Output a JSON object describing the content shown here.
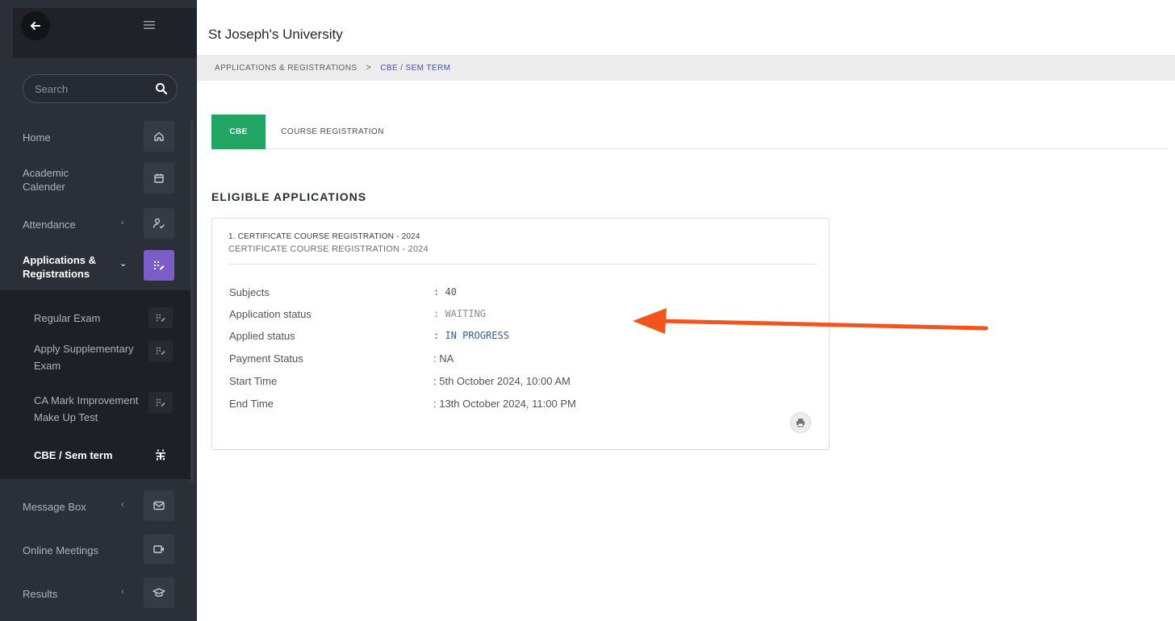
{
  "sidebar": {
    "search_placeholder": "Search",
    "items": [
      {
        "label": "Home"
      },
      {
        "label": "Academic\nCalender"
      },
      {
        "label": "Attendance"
      },
      {
        "label": "Applications &\nRegistrations"
      },
      {
        "label": "Message Box"
      },
      {
        "label": "Online Meetings"
      },
      {
        "label": "Results"
      }
    ],
    "submenu": [
      {
        "label": "Regular Exam"
      },
      {
        "label": "Apply Supplementary\nExam"
      },
      {
        "label": "CA Mark Improvement\nMake Up Test"
      },
      {
        "label": "CBE / Sem term"
      }
    ]
  },
  "header": {
    "title": "St Joseph's University"
  },
  "breadcrumb": {
    "root": "APPLICATIONS & REGISTRATIONS",
    "separator": ">",
    "current": "CBE / SEM TERM"
  },
  "tabs": [
    {
      "label": "CBE"
    },
    {
      "label": "COURSE REGISTRATION"
    }
  ],
  "section": {
    "title": "ELIGIBLE APPLICATIONS"
  },
  "card": {
    "heading": "1. CERTIFICATE COURSE REGISTRATION - 2024",
    "subheading": "CERTIFICATE COURSE REGISTRATION - 2024",
    "rows": [
      {
        "label": "Subjects",
        "value": ": 40"
      },
      {
        "label": "Application status",
        "value": ": WAITING"
      },
      {
        "label": "Applied status",
        "value": ": IN PROGRESS"
      },
      {
        "label": "Payment Status",
        "value": ": NA"
      },
      {
        "label": "Start Time",
        "value": ": 5th October 2024, 10:00 AM"
      },
      {
        "label": "End Time",
        "value": ": 13th October 2024, 11:00 PM"
      }
    ]
  },
  "colors": {
    "sidebar_bg": "#2b2f38",
    "active_icon": "#7c5cc6",
    "active_tab": "#22a563",
    "annotation_arrow": "#f2541b",
    "link_blue": "#2b5fa8"
  }
}
